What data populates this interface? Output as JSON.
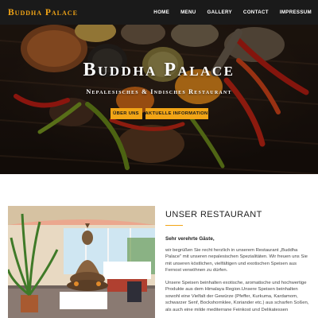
{
  "navbar": {
    "brand": "Buddha Palace",
    "links": [
      "HOME",
      "MENU",
      "GALLERY",
      "CONTACT",
      "IMPRESSUM"
    ]
  },
  "hero": {
    "title": "Buddha Palace",
    "subtitle": "Nepalesisches & Indisches Restaurant",
    "buttons": [
      "ÜBER UNS",
      "AKTUELLE INFORMATION"
    ]
  },
  "about": {
    "heading": "UNSER RESTAURANT",
    "greeting": "Sehr verehrte Gäste,",
    "paragraph1": "wir begrüßen Sie recht herzlich in unserem Restaurant „Buddha Palace\" mit unseren nepalesischen Spezialitäten. Wir freuen uns Sie mit unseren köstlichen, vielfältigen und exotischen Speisen aus Fernost verwöhnen zu dürfen.",
    "paragraph2": "Unsere Speisen beinhalten exotische, aromatische und hochwertige Produkte aus dem Himalaya Region.Unsere Speisen beinhalten sowohl eine Vielfalt der Gewürze (Pfeffer, Kurkuma, Kardamom, schwarzer Senf, Bockshornklee, Koriander etc.) aus scharfen Soßen, als auch eine milde mediterrane Feinkost und Delikatessen"
  },
  "colors": {
    "accent": "#f2a516",
    "navbar_bg": "#1a1a1a",
    "heading_text": "#222222",
    "body_text": "#444444"
  }
}
